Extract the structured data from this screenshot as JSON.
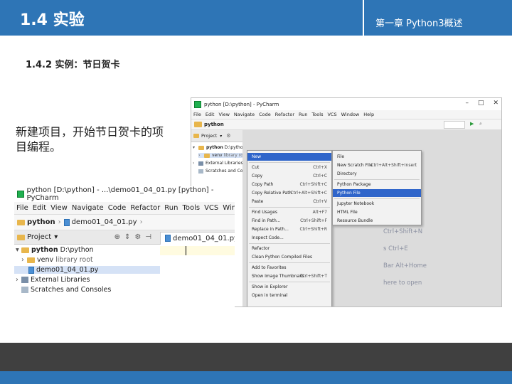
{
  "header": {
    "title": "1.4  实验",
    "chapter": "第一章    Python3概述"
  },
  "subtitle": "1.4.2  实例：节日贺卡",
  "body_text": "新建项目，开始节日贺卡的项目编程。",
  "colors": {
    "header_blue": "#2e75b6",
    "footer_dark": "#404040",
    "selection_blue": "#2f65ca"
  },
  "ide_large": {
    "window_title": "python [D:\\python] - ...\\demo01_04_01.py [python] - PyCharm",
    "menu": [
      "File",
      "Edit",
      "View",
      "Navigate",
      "Code",
      "Refactor",
      "Run",
      "Tools",
      "VCS",
      "Window",
      "Help"
    ],
    "nav": {
      "project": "python",
      "file": "demo01_04_01.py"
    },
    "project_label": "Project",
    "tab_label": "demo01_04_01.py",
    "tree": {
      "root": "python",
      "root_path": "D:\\python",
      "venv": "venv",
      "venv_note": "library root",
      "file": "demo01_04_01.py",
      "external": "External Libraries",
      "scratches": "Scratches and Consoles"
    }
  },
  "ide_small": {
    "window_title": "python [D:\\python] - PyCharm",
    "menu": [
      "File",
      "Edit",
      "View",
      "Navigate",
      "Code",
      "Refactor",
      "Run",
      "Tools",
      "VCS",
      "Window",
      "Help"
    ],
    "nav_project": "python",
    "project_label": "Project",
    "tree": {
      "root": "python",
      "root_path": "D:\\python",
      "venv": "venv",
      "venv_note": "library root",
      "external": "External Libraries",
      "scratches": "Scratches and Consoles"
    },
    "context_menu": [
      {
        "label": "New",
        "shortcut": "",
        "selected": true
      },
      {
        "label": "Cut",
        "shortcut": "Ctrl+X"
      },
      {
        "label": "Copy",
        "shortcut": "Ctrl+C"
      },
      {
        "label": "Copy Path",
        "shortcut": "Ctrl+Shift+C"
      },
      {
        "label": "Copy Relative Path",
        "shortcut": "Ctrl+Alt+Shift+C"
      },
      {
        "label": "Paste",
        "shortcut": "Ctrl+V"
      },
      {
        "label": "Find Usages",
        "shortcut": "Alt+F7"
      },
      {
        "label": "Find in Path...",
        "shortcut": "Ctrl+Shift+F"
      },
      {
        "label": "Replace in Path...",
        "shortcut": "Ctrl+Shift+R"
      },
      {
        "label": "Inspect Code...",
        "shortcut": ""
      },
      {
        "label": "Refactor",
        "shortcut": ""
      },
      {
        "label": "Clean Python Compiled Files",
        "shortcut": ""
      },
      {
        "label": "Add to Favorites",
        "shortcut": ""
      },
      {
        "label": "Show Image Thumbnails",
        "shortcut": "Ctrl+Shift+T"
      },
      {
        "label": "Show in Explorer",
        "shortcut": ""
      },
      {
        "label": "Open in terminal",
        "shortcut": ""
      }
    ],
    "submenu": [
      {
        "label": "File",
        "shortcut": ""
      },
      {
        "label": "New Scratch File",
        "shortcut": "Ctrl+Alt+Shift+Insert"
      },
      {
        "label": "Directory",
        "shortcut": ""
      },
      {
        "label": "Python Package",
        "shortcut": ""
      },
      {
        "label": "Python File",
        "shortcut": "",
        "selected": true
      },
      {
        "label": "Jupyter Notebook",
        "shortcut": ""
      },
      {
        "label": "HTML File",
        "shortcut": ""
      },
      {
        "label": "Resource Bundle",
        "shortcut": ""
      }
    ],
    "hints": [
      "Ctrl+Shift+N",
      "s Ctrl+E",
      "Bar Alt+Home",
      "here to open"
    ]
  }
}
